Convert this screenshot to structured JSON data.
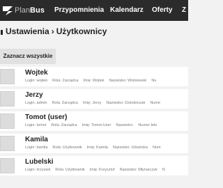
{
  "app": {
    "brand_light": "Plan",
    "brand_strong": "Bus"
  },
  "nav": {
    "items": [
      {
        "label": "Przypomnienia"
      },
      {
        "label": "Kalendarz"
      },
      {
        "label": "Oferty"
      },
      {
        "label": "Z"
      }
    ]
  },
  "breadcrumb": {
    "parent": "Ustawienia",
    "separator": "›",
    "current": "Użytkownicy"
  },
  "toolbar": {
    "select_all_label": "Zaznacz wszystkie"
  },
  "users": [
    {
      "name": "Wojtek",
      "login": "Login: wojtek",
      "role": "Rola: Zarządca",
      "first": "Imię: Wojtek",
      "last": "Nazwisko: Wiśniewski",
      "extra": "Nu"
    },
    {
      "name": "Jerzy",
      "login": "Login: admin",
      "role": "Rola: Zarządca",
      "first": "Imię: Jerzy",
      "last": "Nazwisko: Dziedziczak",
      "extra": "Nume"
    },
    {
      "name": "Tomot (user)",
      "login": "Login: tomot",
      "role": "Rola: Zarządca",
      "first": "Imię: Tomot-User",
      "last": "Nazwisko:",
      "extra": "Numer tele"
    },
    {
      "name": "Kamila",
      "login": "Login: kamila",
      "role": "Rola: Użytkownik",
      "first": "Imię: Kamila",
      "last": "Nazwisko: Urbańska",
      "extra": "Num"
    },
    {
      "name": "Lubelski",
      "login": "Login: krzysiek",
      "role": "Rola: Użytkownik",
      "first": "Imię: Krzysztof",
      "last": "Nazwisko: Młynarczyk",
      "extra": "N"
    }
  ],
  "colors": {
    "topbar": "#2b2b2b",
    "page_bg": "#f2f2f2",
    "row_bg": "#ffffff",
    "button_bg": "#e1e1e1"
  }
}
